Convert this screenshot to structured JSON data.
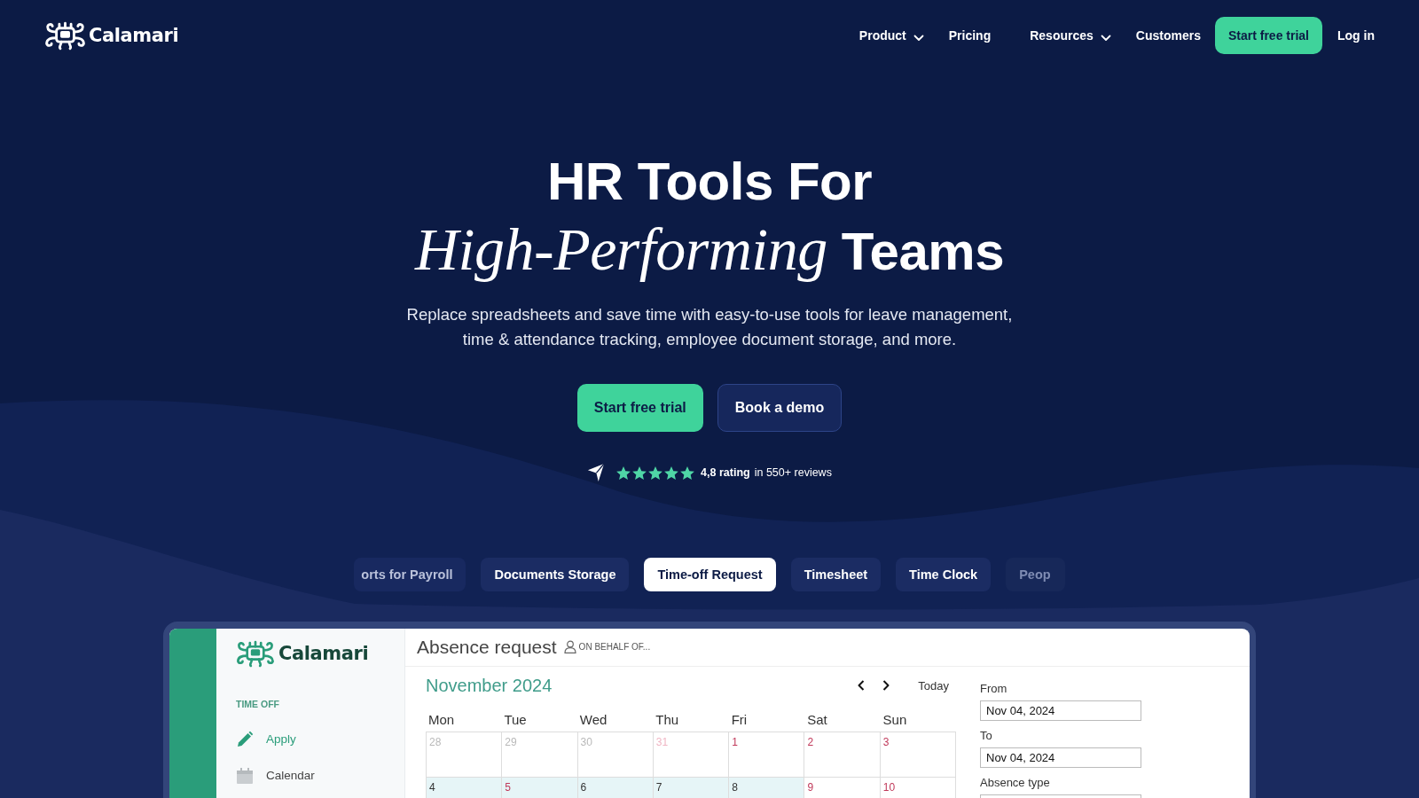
{
  "header": {
    "logo": "Calamari",
    "nav": [
      {
        "label": "Product",
        "dropdown": true
      },
      {
        "label": "Pricing",
        "dropdown": false
      },
      {
        "label": "Resources",
        "dropdown": true
      },
      {
        "label": "Customers",
        "dropdown": false
      }
    ],
    "cta_button": "Start free trial",
    "login_link": "Log in"
  },
  "hero": {
    "title_lines": [
      "HR Tools For",
      "*High-Performing* Teams"
    ],
    "subtitle": "Replace spreadsheets and save time with easy-to-use tools for leave management, time & attendance tracking, employee document storage, and more.",
    "buttons": [
      {
        "label": "Start free trial",
        "kind": "primary"
      },
      {
        "label": "Book a demo",
        "kind": "secondary"
      }
    ],
    "rating": {
      "stars": 5,
      "score": "4,8 rating",
      "reviews": "in 550+ reviews"
    }
  },
  "feature_tabs": [
    {
      "label": "orts for Payroll",
      "selected": false
    },
    {
      "label": "Documents Storage",
      "selected": false
    },
    {
      "label": "Time-off Request",
      "selected": true
    },
    {
      "label": "Timesheet",
      "selected": false
    },
    {
      "label": "Time Clock",
      "selected": false
    },
    {
      "label": "Peop",
      "selected": false
    }
  ],
  "app_preview": {
    "logo": "Calamari",
    "sidebar": {
      "section": "TIME OFF",
      "items": [
        {
          "label": "Apply",
          "selected": true
        },
        {
          "label": "Calendar",
          "selected": false
        }
      ]
    },
    "page_title": "Absence request",
    "on_behalf": "ON BEHALF OF...",
    "calendar": {
      "month": "November 2024",
      "today_button": "Today",
      "weekdays": [
        "Mon",
        "Tue",
        "Wed",
        "Thu",
        "Fri",
        "Sat",
        "Sun"
      ],
      "weeks": [
        [
          {
            "day": "28",
            "outside_month": true,
            "non_working": false,
            "highlighted": false
          },
          {
            "day": "29",
            "outside_month": true,
            "non_working": false,
            "highlighted": false
          },
          {
            "day": "30",
            "outside_month": true,
            "non_working": false,
            "highlighted": false
          },
          {
            "day": "31",
            "outside_month": true,
            "non_working": true,
            "highlighted": false
          },
          {
            "day": "1",
            "outside_month": false,
            "non_working": true,
            "highlighted": false
          },
          {
            "day": "2",
            "outside_month": false,
            "non_working": true,
            "highlighted": false
          },
          {
            "day": "3",
            "outside_month": false,
            "non_working": true,
            "highlighted": false
          }
        ],
        [
          {
            "day": "4",
            "outside_month": false,
            "non_working": false,
            "highlighted": true
          },
          {
            "day": "5",
            "outside_month": false,
            "non_working": true,
            "highlighted": true
          },
          {
            "day": "6",
            "outside_month": false,
            "non_working": false,
            "highlighted": true
          },
          {
            "day": "7",
            "outside_month": false,
            "non_working": false,
            "highlighted": true
          },
          {
            "day": "8",
            "outside_month": false,
            "non_working": false,
            "highlighted": true
          },
          {
            "day": "9",
            "outside_month": false,
            "non_working": true,
            "highlighted": false
          },
          {
            "day": "10",
            "outside_month": false,
            "non_working": true,
            "highlighted": false
          }
        ]
      ]
    },
    "form": {
      "fields": [
        {
          "label": "From",
          "value": "Nov 04, 2024"
        },
        {
          "label": "To",
          "value": "Nov 04, 2024"
        },
        {
          "label": "Absence type"
        }
      ]
    }
  }
}
